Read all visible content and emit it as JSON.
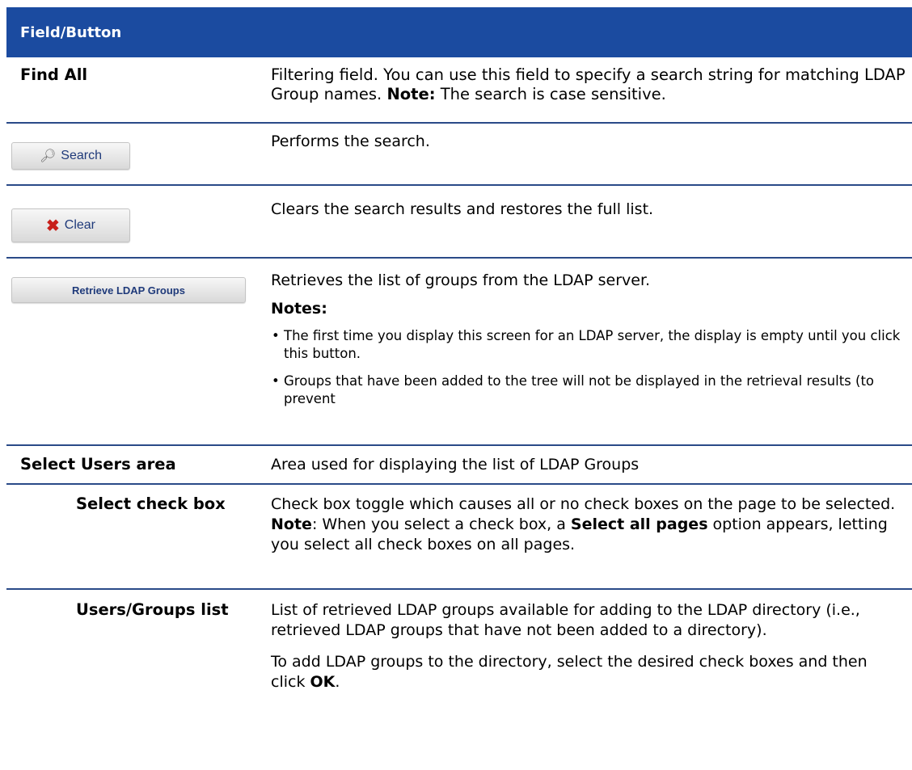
{
  "header": {
    "title": "Field/Button"
  },
  "rows": {
    "find_all": {
      "label": "Find All",
      "desc_part1": "Filtering field. You can use this field to specify a search string for matching LDAP Group names. ",
      "desc_bold": "Note:",
      "desc_part2": " The search is case sensitive."
    },
    "search": {
      "button_label": "Search",
      "icon": "search-icon",
      "desc": "Performs the search."
    },
    "clear": {
      "button_label": "Clear",
      "icon": "close-icon",
      "desc": "Clears the search results and restores the full list."
    },
    "retrieve": {
      "button_label": "Retrieve LDAP Groups",
      "desc": "Retrieves the list of groups from the LDAP server.",
      "notes_title": "Notes:",
      "notes": [
        "The first time you display this screen for an LDAP server, the display is empty until you click this button.",
        "Groups that have been added to the tree will not be displayed in the retrieval results (to prevent"
      ]
    },
    "select_users_area": {
      "label": "Select Users area",
      "desc": "Area used for displaying the list of LDAP Groups"
    },
    "select_check_box": {
      "label": "Select check box",
      "desc_part1": "Check box toggle which causes all or no check boxes on the page to be selected. ",
      "desc_bold1": "Note",
      "desc_part2": ": When you select a check box, a ",
      "desc_bold2": "Select all pages",
      "desc_part3": " option appears, letting you select all check boxes on all pages."
    },
    "users_groups_list": {
      "label": "Users/Groups list",
      "desc": "List of retrieved LDAP groups available for adding to the LDAP directory (i.e., retrieved LDAP groups that have not been added to a directory).",
      "desc2_part1": "To add LDAP groups to the directory, select the desired check boxes and then click ",
      "desc2_bold": "OK",
      "desc2_part2": "."
    }
  }
}
